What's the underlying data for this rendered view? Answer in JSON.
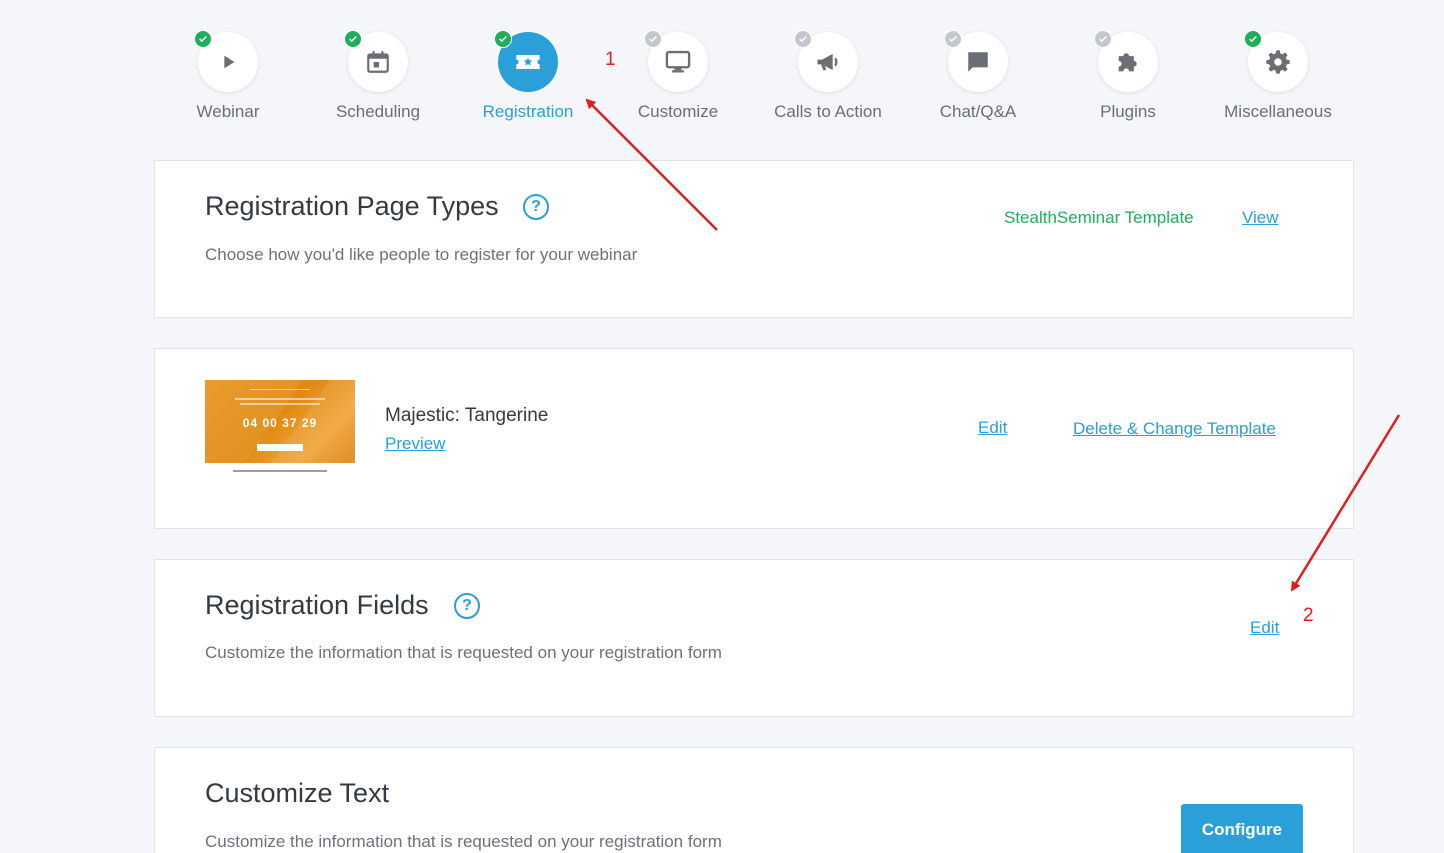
{
  "steps": [
    {
      "label": "Webinar",
      "icon": "play-icon",
      "status": "done"
    },
    {
      "label": "Scheduling",
      "icon": "calendar-icon",
      "status": "done"
    },
    {
      "label": "Registration",
      "icon": "ticket-icon",
      "status": "done"
    },
    {
      "label": "Customize",
      "icon": "monitor-icon",
      "status": "pending"
    },
    {
      "label": "Calls to Action",
      "icon": "megaphone-icon",
      "status": "pending"
    },
    {
      "label": "Chat/Q&A",
      "icon": "chat-icon",
      "status": "pending"
    },
    {
      "label": "Plugins",
      "icon": "puzzle-icon",
      "status": "pending"
    },
    {
      "label": "Miscellaneous",
      "icon": "gear-icon",
      "status": "done"
    }
  ],
  "active_step": "Registration",
  "page_types": {
    "title": "Registration Page Types",
    "description": "Choose how you'd like people to register for your webinar",
    "template_label": "StealthSeminar Template",
    "view_link": "View"
  },
  "template": {
    "name": "Majestic: Tangerine",
    "preview_link": "Preview",
    "edit_link": "Edit",
    "delete_link": "Delete & Change Template",
    "thumbnail_countdown": "04  00  37  29"
  },
  "registration_fields": {
    "title": "Registration Fields",
    "description": "Customize the information that is requested on your registration form",
    "edit_link": "Edit"
  },
  "customize_text": {
    "title": "Customize Text",
    "description": "Customize the information that is requested on your registration form",
    "configure_button": "Configure"
  },
  "annotations": {
    "marker_1": "1",
    "marker_2": "2"
  },
  "colors": {
    "accent": "#2a9fd8",
    "done": "#1fae5b",
    "pending": "#c4c7cc",
    "annotation": "#e01e1e",
    "template_orange": "#e7931d"
  }
}
